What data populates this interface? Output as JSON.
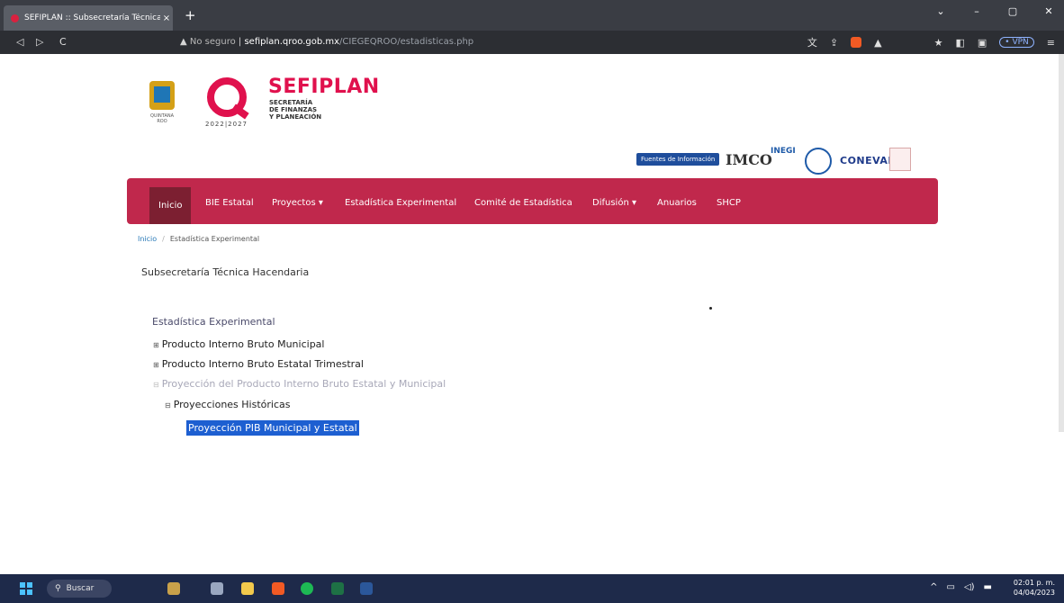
{
  "browser": {
    "tab_title": "SEFIPLAN :: Subsecretaría Técnica",
    "tab_close": "×",
    "new_tab": "+",
    "security": "No seguro",
    "url_host": "sefiplan.qroo.gob.mx",
    "url_path": "/CIEGEQROO/estadisticas.php",
    "vpn_label": "• VPN",
    "window_controls": [
      "⌄",
      "–",
      "▢",
      "✕"
    ]
  },
  "header": {
    "brand_name": "SEFIPLAN",
    "brand_sub_1": "SECRETARÍA",
    "brand_sub_2": "DE FINANZAS",
    "brand_sub_3": "Y PLANEACIÓN",
    "year_range": "2022|2027",
    "coat_caption": "QUINTANA ROO"
  },
  "partners": {
    "info_button": "Fuentes de Información",
    "imco": "IMCO",
    "inegi": "INEGI",
    "coneval": "CONEVAL"
  },
  "navbar": {
    "items": [
      {
        "label": "Inicio"
      },
      {
        "label": "BIE Estatal"
      },
      {
        "label": "Proyectos ▾"
      },
      {
        "label": "Estadística Experimental"
      },
      {
        "label": "Comité de Estadística"
      },
      {
        "label": "Difusión ▾"
      },
      {
        "label": "Anuarios"
      },
      {
        "label": "SHCP"
      }
    ]
  },
  "breadcrumb": {
    "home": "Inicio",
    "separator": "/",
    "current": "Estadística Experimental"
  },
  "main": {
    "heading": "Subsecretaría Técnica Hacendaria",
    "tree_title": "Estadística Experimental",
    "tree": [
      {
        "toggle": "⊞",
        "label": "Producto Interno Bruto Municipal"
      },
      {
        "toggle": "⊞",
        "label": "Producto Interno Bruto Estatal Trimestral"
      },
      {
        "toggle": "⊟",
        "label": "Proyección del Producto Interno Bruto Estatal y Municipal"
      },
      {
        "toggle": "⊟",
        "label": "Proyecciones Históricas"
      }
    ],
    "selected_leaf": "Proyección PIB Municipal y Estatal"
  },
  "taskbar": {
    "search_label": "Buscar",
    "time": "02:01 p. m.",
    "date": "04/04/2023"
  },
  "colors": {
    "brand": "#e0114d",
    "navbar": "#c0284c",
    "navbar_active": "#7c1f31",
    "selection": "#1d5fd1"
  }
}
